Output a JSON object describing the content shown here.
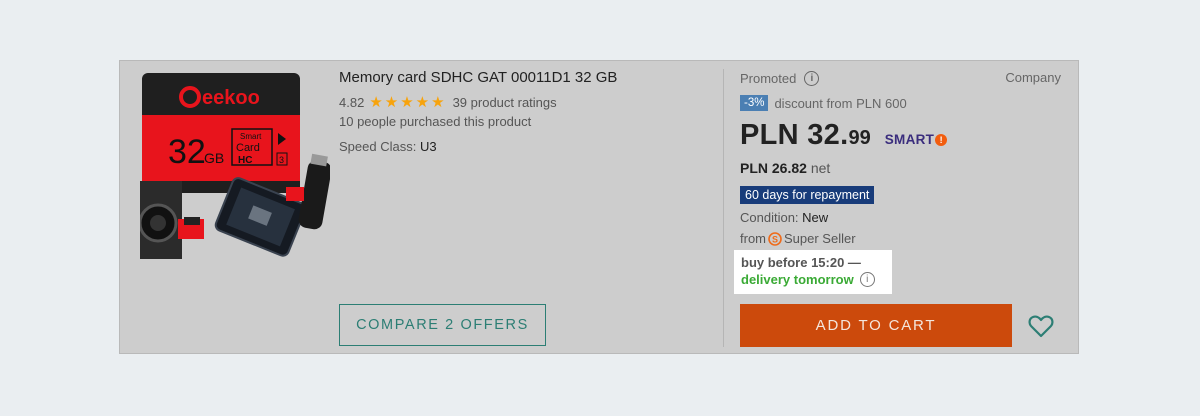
{
  "product": {
    "title": "Memory card SDHC GAT 00011D1 32 GB",
    "image": {
      "brand": "eekoo",
      "capacity": "32",
      "unit": "GB",
      "card_text_1": "Smart",
      "card_text_2": "Card",
      "card_text_3": "HC",
      "card_text_4": "3"
    },
    "rating_value": "4.82",
    "stars": 5,
    "ratings_text": "39 product ratings",
    "purchased_text": "10 people purchased this product",
    "speed_label": "Speed Class:",
    "speed_value": "U3",
    "compare_label": "COMPARE 2 OFFERS"
  },
  "offer": {
    "promoted_label": "Promoted",
    "seller_type": "Company",
    "discount_badge": "-3%",
    "discount_text": "discount from PLN 600",
    "price_main": "PLN 32.",
    "price_cents": "99",
    "smart_label": "SMART",
    "net_price": "PLN 26.82",
    "net_label": "net",
    "repayment": "60 days for repayment",
    "condition_label": "Condition:",
    "condition_value": "New",
    "from_label": "from",
    "seller_label": "Super Seller",
    "delivery_line1": "buy before 15:20 —",
    "delivery_line2": "delivery tomorrow",
    "cart_label": "ADD TO CART"
  },
  "colors": {
    "accent_orange": "#cc4a0c",
    "teal": "#2c7e74",
    "delivery_green": "#3aaa35",
    "repay_blue": "#183c7a",
    "star": "#f7a30c"
  },
  "icons": [
    "info-icon",
    "star-icon",
    "super-seller-icon",
    "smart-icon",
    "heart-icon"
  ]
}
